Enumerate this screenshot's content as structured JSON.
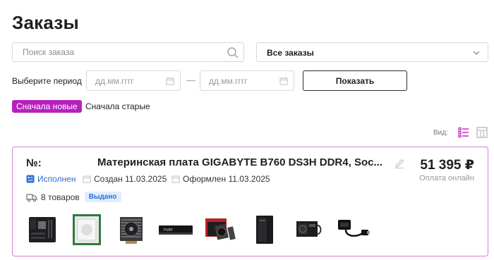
{
  "page": {
    "title": "Заказы"
  },
  "filters": {
    "search_placeholder": "Поиск заказа",
    "orders_select_value": "Все заказы",
    "period_label": "Выберите период",
    "date_from_placeholder": "дд.мм.гггг",
    "date_to_placeholder": "дд.мм.гггг",
    "date_separator": "—",
    "show_button": "Показать",
    "sort_newest": "Сначала новые",
    "sort_oldest": "Сначала старые",
    "view_label": "Вид:"
  },
  "order": {
    "number_label": "№:",
    "product_name": "Материнская плата GIGABYTE B760 DS3H DDR4, Soc...",
    "price": "51 395 ₽",
    "payment": "Оплата онлайн",
    "status": "Исполнен",
    "created": "Создан 11.03.2025",
    "placed": "Оформлен 11.03.2025",
    "items_count": "8 товаров",
    "badge": "Выдано",
    "items": [
      {
        "icon": "motherboard-image"
      },
      {
        "icon": "cpu-image"
      },
      {
        "icon": "cpu-cooler-image"
      },
      {
        "icon": "ram-module-image"
      },
      {
        "icon": "graphics-card-image"
      },
      {
        "icon": "pc-case-image"
      },
      {
        "icon": "power-supply-image"
      },
      {
        "icon": "hdmi-adapter-image"
      }
    ]
  },
  "colors": {
    "accent": "#b81fc0",
    "card_border": "#d57fdb",
    "status_blue": "#2f6fd0",
    "badge_bg": "#dfeeff"
  }
}
